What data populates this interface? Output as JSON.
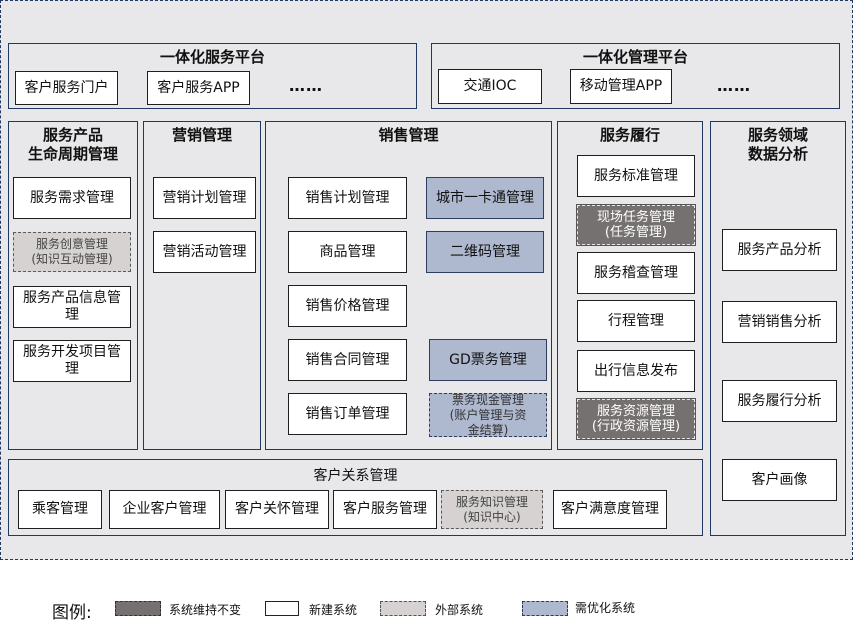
{
  "top": {
    "service_platform": {
      "title": "一体化服务平台",
      "items": [
        "客户服务门户",
        "客户服务APP"
      ],
      "more": "……"
    },
    "management_platform": {
      "title": "一体化管理平台",
      "items": [
        "交通IOC",
        "移动管理APP"
      ],
      "more": "……"
    }
  },
  "lifecycle": {
    "title": "服务产品\n生命周期管理",
    "items": [
      "服务需求管理",
      "服务创意管理\n(知识互动管理)",
      "服务产品信息管\n理",
      "服务开发项目管\n理"
    ]
  },
  "marketing": {
    "title": "营销管理",
    "items": [
      "营销计划管理",
      "营销活动管理"
    ]
  },
  "sales": {
    "title": "销售管理",
    "left_items": [
      "销售计划管理",
      "商品管理",
      "销售价格管理",
      "销售合同管理",
      "销售订单管理"
    ],
    "right_items": [
      "城市一卡通管理",
      "二维码管理",
      "GD票务管理",
      "票务现金管理\n(账户管理与资\n金结算)"
    ]
  },
  "fulfillment": {
    "title": "服务履行",
    "items": [
      "服务标准管理",
      "现场任务管理\n(任务管理)",
      "服务稽查管理",
      "行程管理",
      "出行信息发布",
      "服务资源管理\n(行政资源管理)"
    ]
  },
  "analytics": {
    "title": "服务领域\n数据分析",
    "items": [
      "服务产品分析",
      "营销销售分析",
      "服务履行分析",
      "客户画像"
    ]
  },
  "crm": {
    "title": "客户关系管理",
    "items": [
      "乘客管理",
      "企业客户管理",
      "客户关怀管理",
      "客户服务管理",
      "服务知识管理\n(知识中心)",
      "客户满意度管理"
    ]
  },
  "legend": {
    "label": "图例:",
    "items": [
      "系统维持不变",
      "新建系统",
      "外部系统",
      "需优化系统"
    ]
  },
  "colors": {
    "unchanged": "#757170",
    "new": "#ffffff",
    "external": "#d6d2d2",
    "optimize": "#aeb9d0",
    "border": "#1f3864"
  }
}
